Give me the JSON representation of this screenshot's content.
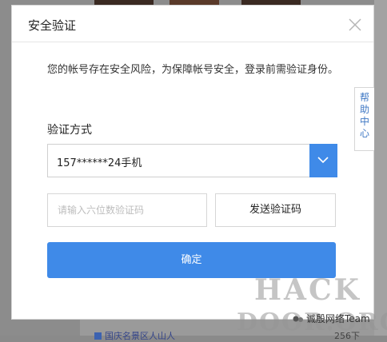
{
  "modal": {
    "title": "安全验证",
    "notice": "您的帐号存在安全风险，为保障帐号安全，登录前需验证身份。",
    "method_label": "验证方式",
    "method_value": "157******24手机",
    "code_placeholder": "请输入六位数验证码",
    "send_code_label": "发送验证码",
    "confirm_label": "确定"
  },
  "help_tab": {
    "chars": [
      "帮",
      "助",
      "中",
      "心"
    ]
  },
  "background": {
    "bottom_link": "国庆名景区人山人",
    "bottom_count": "256下"
  },
  "watermark": {
    "line1": "HACK",
    "line2": "DOOR.ORG",
    "team": "诚殷网络Team"
  },
  "colors": {
    "accent": "#3f8ae8",
    "help_text": "#3f78c4"
  }
}
